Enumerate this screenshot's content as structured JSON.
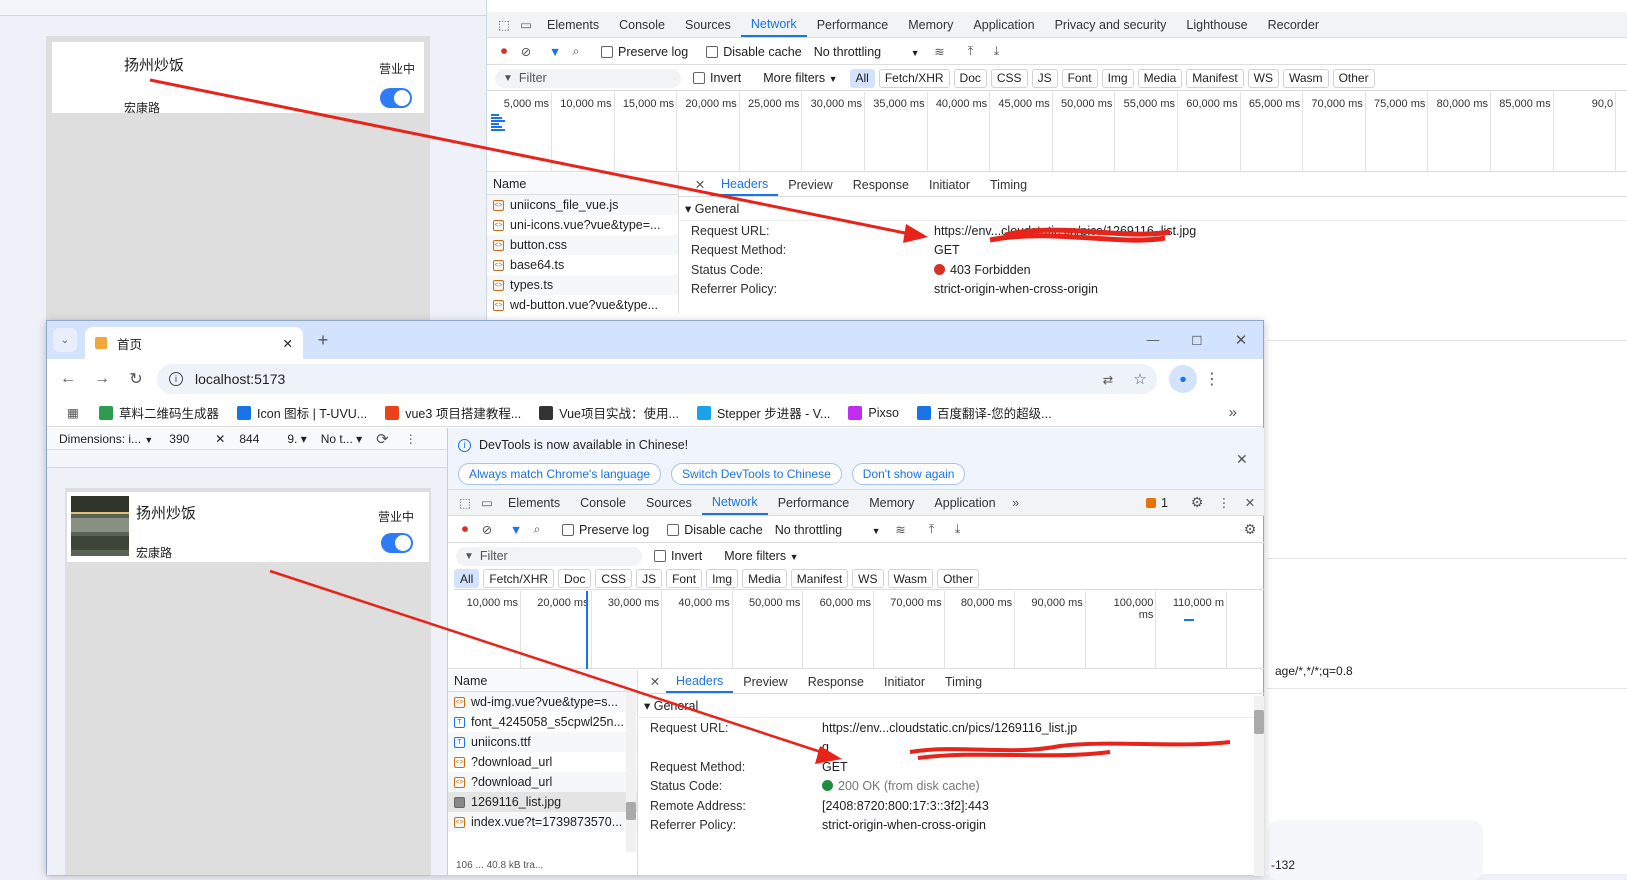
{
  "back_devtools": {
    "tabs": [
      "Elements",
      "Console",
      "Sources",
      "Network",
      "Performance",
      "Memory",
      "Application",
      "Privacy and security",
      "Lighthouse",
      "Recorder"
    ],
    "active_tab": "Network",
    "preserve_log": "Preserve log",
    "disable_cache": "Disable cache",
    "throttling": "No throttling",
    "filter_placeholder": "Filter",
    "invert": "Invert",
    "more_filters": "More filters",
    "type_filters": [
      "All",
      "Fetch/XHR",
      "Doc",
      "CSS",
      "JS",
      "Font",
      "Img",
      "Media",
      "Manifest",
      "WS",
      "Wasm",
      "Other"
    ],
    "timeline_ticks": [
      "5,000 ms",
      "10,000 ms",
      "15,000 ms",
      "20,000 ms",
      "25,000 ms",
      "30,000 ms",
      "35,000 ms",
      "40,000 ms",
      "45,000 ms",
      "50,000 ms",
      "55,000 ms",
      "60,000 ms",
      "65,000 ms",
      "70,000 ms",
      "75,000 ms",
      "80,000 ms",
      "85,000 ms",
      "90,0"
    ],
    "name_header": "Name",
    "files": [
      "uniicons_file_vue.js",
      "uni-icons.vue?vue&type=...",
      "button.css",
      "base64.ts",
      "types.ts",
      "wd-button.vue?vue&type..."
    ],
    "detail_tabs": [
      "Headers",
      "Preview",
      "Response",
      "Initiator",
      "Timing"
    ],
    "general": "General",
    "headers": [
      {
        "label": "Request URL:",
        "value": "https://env...cloudstatic.cn/pics/1269116_list.jpg"
      },
      {
        "label": "Request Method:",
        "value": "GET"
      },
      {
        "label": "Status Code:",
        "value": "403 Forbidden"
      },
      {
        "label": "Referrer Policy:",
        "value": "strict-origin-when-cross-origin"
      }
    ],
    "status_color": "#d93025",
    "partial_accept": "age/*,*/*;q=0.8",
    "partial_addr": "-132"
  },
  "back_page": {
    "shop_name": "扬州炒饭",
    "status": "营业中",
    "address": "宏康路"
  },
  "browser": {
    "tab_title": "首页",
    "url": "localhost:5173",
    "bookmarks": [
      "草料二维码生成器",
      "Icon 图标 | T-UVU...",
      "vue3 项目搭建教程...",
      "Vue项目实战：使用...",
      "Stepper 步进器 - V...",
      "Pixso",
      "百度翻译-您的超级..."
    ],
    "device_toolbar": {
      "dimensions": "Dimensions: i...",
      "width": "390",
      "height": "844",
      "zoom": "9.",
      "throttle": "No t..."
    }
  },
  "front_page": {
    "shop_name": "扬州炒饭",
    "status": "营业中",
    "address": "宏康路"
  },
  "front_devtools": {
    "banner_text": "DevTools is now available in Chinese!",
    "banner_buttons": [
      "Always match Chrome's language",
      "Switch DevTools to Chinese",
      "Don't show again"
    ],
    "tabs": [
      "Elements",
      "Console",
      "Sources",
      "Network",
      "Performance",
      "Memory",
      "Application"
    ],
    "active_tab": "Network",
    "issues_count": "1",
    "preserve_log": "Preserve log",
    "disable_cache": "Disable cache",
    "throttling": "No throttling",
    "filter_placeholder": "Filter",
    "invert": "Invert",
    "more_filters": "More filters",
    "type_filters": [
      "All",
      "Fetch/XHR",
      "Doc",
      "CSS",
      "JS",
      "Font",
      "Img",
      "Media",
      "Manifest",
      "WS",
      "Wasm",
      "Other"
    ],
    "timeline_ticks": [
      "10,000 ms",
      "20,000 ms",
      "30,000 ms",
      "40,000 ms",
      "50,000 ms",
      "60,000 ms",
      "70,000 ms",
      "80,000 ms",
      "90,000 ms",
      "100,000 ms",
      "110,000 m"
    ],
    "name_header": "Name",
    "files": [
      {
        "name": "wd-img.vue?vue&type=s...",
        "kind": "js"
      },
      {
        "name": "font_4245058_s5cpwl25n...",
        "kind": "font"
      },
      {
        "name": "uniicons.ttf",
        "kind": "font"
      },
      {
        "name": "?download_url",
        "kind": "js"
      },
      {
        "name": "?download_url",
        "kind": "js"
      },
      {
        "name": "1269116_list.jpg",
        "kind": "img"
      },
      {
        "name": "index.vue?t=1739873570...",
        "kind": "js"
      }
    ],
    "detail_tabs": [
      "Headers",
      "Preview",
      "Response",
      "Initiator",
      "Timing"
    ],
    "general": "General",
    "headers": [
      {
        "label": "Request URL:",
        "value": "https://env...cloudstatic.cn/pics/1269116_list.jp"
      },
      {
        "label": "",
        "value": "g"
      },
      {
        "label": "Request Method:",
        "value": "GET"
      },
      {
        "label": "Status Code:",
        "value": "200 OK (from disk cache)"
      },
      {
        "label": "Remote Address:",
        "value": "[2408:8720:800:17:3::3f2]:443"
      },
      {
        "label": "Referrer Policy:",
        "value": "strict-origin-when-cross-origin"
      }
    ],
    "status_color": "#1e8e3e",
    "bottom_partial": "106 ... 40.8 kB tra..."
  }
}
